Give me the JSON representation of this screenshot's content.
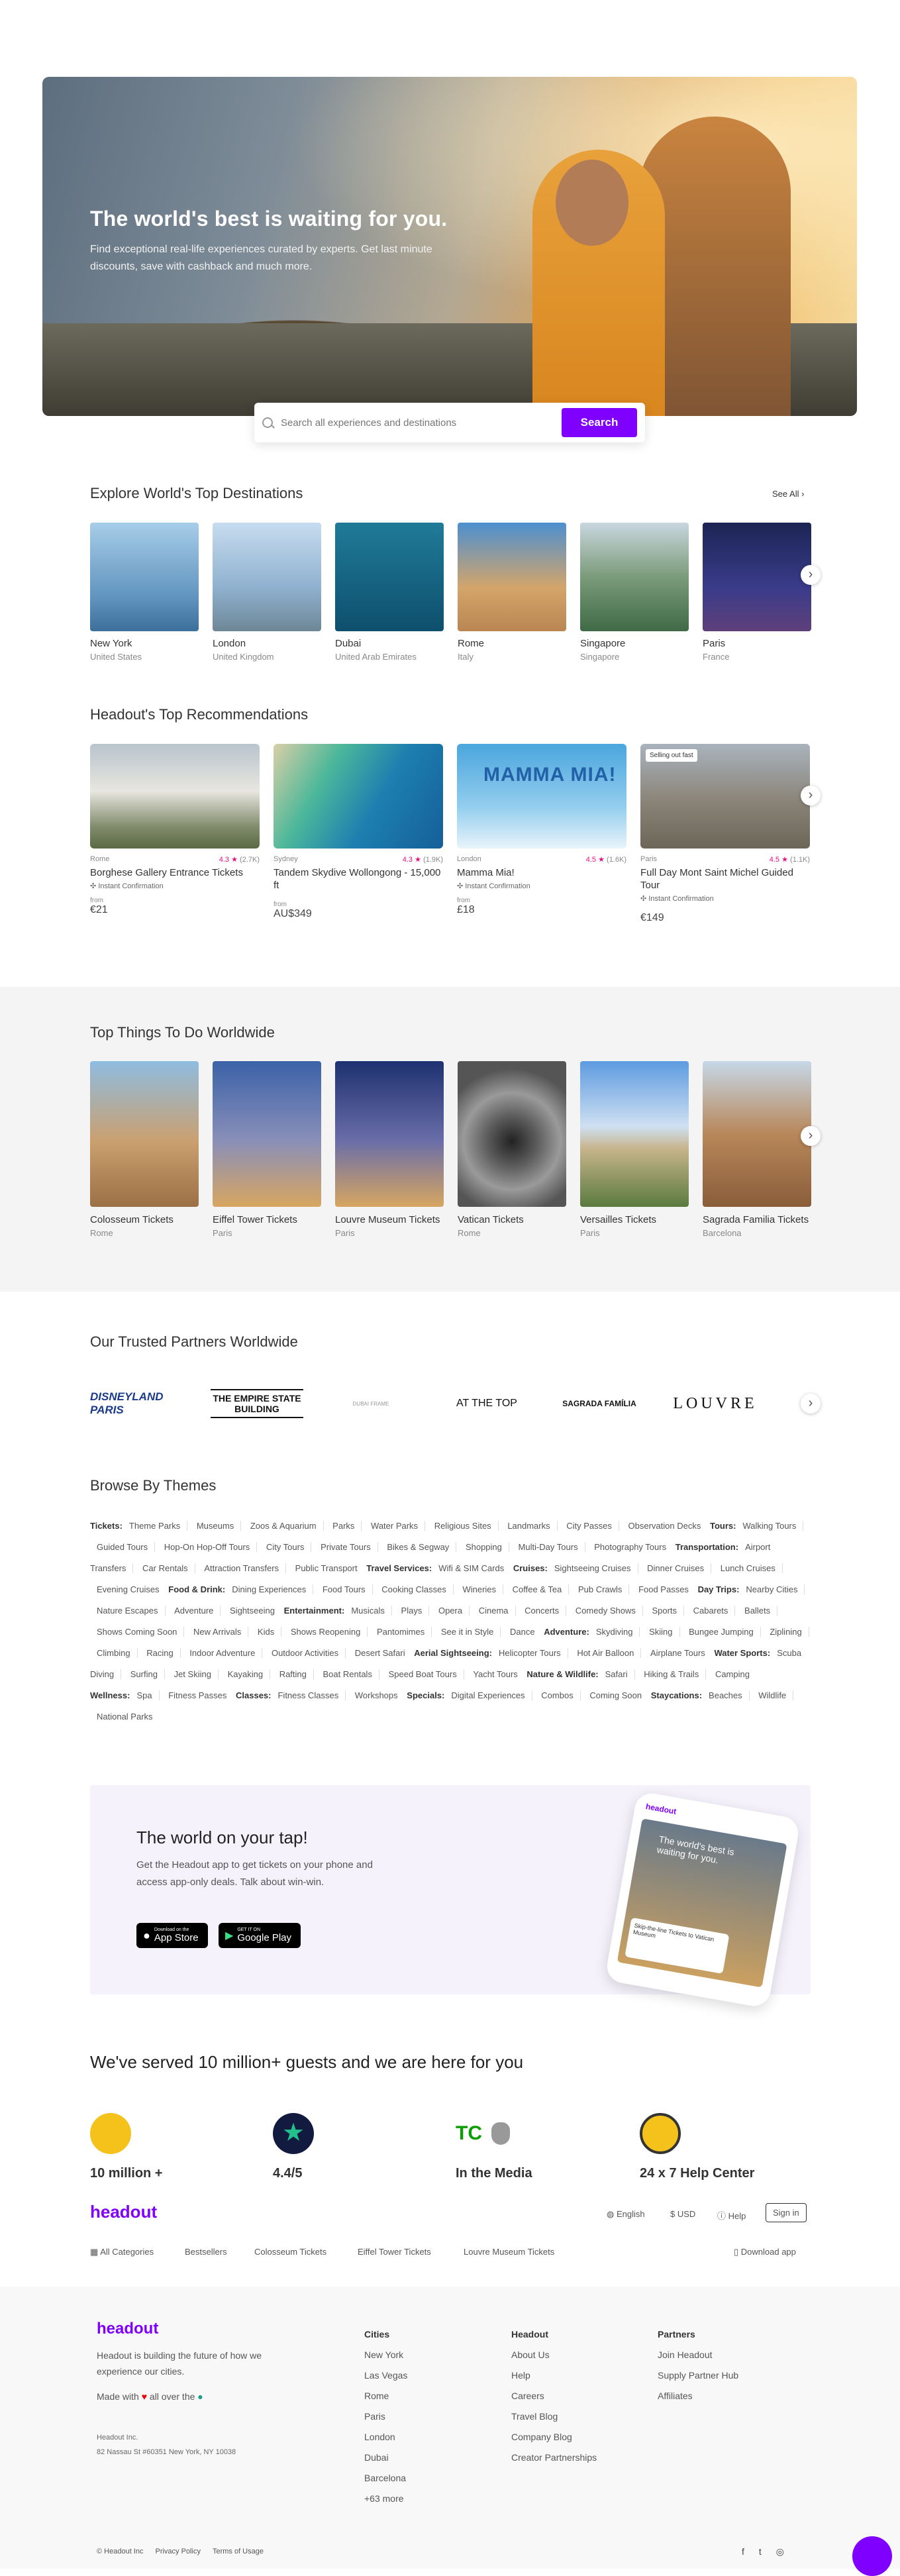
{
  "hero": {
    "title": "The world's best is waiting for you.",
    "subtitle": "Find exceptional real-life experiences curated by experts. Get last minute discounts, save with cashback and much more."
  },
  "search": {
    "placeholder": "Search all experiences and destinations",
    "button": "Search"
  },
  "destinations": {
    "title": "Explore World's Top Destinations",
    "see_all": "See All",
    "items": [
      {
        "name": "New York",
        "country": "United States"
      },
      {
        "name": "London",
        "country": "United Kingdom"
      },
      {
        "name": "Dubai",
        "country": "United Arab Emirates"
      },
      {
        "name": "Rome",
        "country": "Italy"
      },
      {
        "name": "Singapore",
        "country": "Singapore"
      },
      {
        "name": "Paris",
        "country": "France"
      }
    ]
  },
  "recommendations": {
    "title": "Headout's Top Recommendations",
    "items": [
      {
        "city": "Rome",
        "rating": "4.3 ★",
        "count": "(2.7K)",
        "title": "Borghese Gallery Entrance Tickets",
        "feature": "Instant Confirmation",
        "from": "from",
        "price": "€21",
        "badge": ""
      },
      {
        "city": "Sydney",
        "rating": "4.3 ★",
        "count": "(1.9K)",
        "title": "Tandem Skydive Wollongong - 15,000 ft",
        "feature": "",
        "from": "from",
        "price": "AU$349",
        "badge": ""
      },
      {
        "city": "London",
        "rating": "4.5 ★",
        "count": "(1.6K)",
        "title": "Mamma Mia!",
        "feature": "Instant Confirmation",
        "from": "from",
        "price": "£18",
        "badge": ""
      },
      {
        "city": "Paris",
        "rating": "4.5 ★",
        "count": "(1.1K)",
        "title": "Full Day Mont Saint Michel Guided Tour",
        "feature": "Instant Confirmation",
        "from": "",
        "price": "€149",
        "badge": "Selling out fast"
      }
    ]
  },
  "things": {
    "title": "Top Things To Do Worldwide",
    "items": [
      {
        "name": "Colosseum Tickets",
        "city": "Rome"
      },
      {
        "name": "Eiffel Tower Tickets",
        "city": "Paris"
      },
      {
        "name": "Louvre Museum Tickets",
        "city": "Paris"
      },
      {
        "name": "Vatican Tickets",
        "city": "Rome"
      },
      {
        "name": "Versailles Tickets",
        "city": "Paris"
      },
      {
        "name": "Sagrada Familia Tickets",
        "city": "Barcelona"
      }
    ]
  },
  "partners": {
    "title": "Our Trusted Partners Worldwide",
    "logos": [
      "DISNEYLAND PARIS",
      "THE EMPIRE STATE BUILDING",
      "DUBAI FRAME",
      "AT THE TOP",
      "SAGRADA FAMÍLIA",
      "LOUVRE"
    ]
  },
  "themes": {
    "title": "Browse By Themes",
    "groups": [
      {
        "label": "Tickets:",
        "items": [
          "Theme Parks",
          "Museums",
          "Zoos & Aquarium",
          "Parks",
          "Water Parks",
          "Religious Sites",
          "Landmarks",
          "City Passes",
          "Observation Decks"
        ]
      },
      {
        "label": "Tours:",
        "items": [
          "Walking Tours",
          "Guided Tours",
          "Hop-On Hop-Off Tours",
          "City Tours",
          "Private Tours",
          "Bikes & Segway",
          "Shopping",
          "Multi-Day Tours",
          "Photography Tours"
        ]
      },
      {
        "label": "Transportation:",
        "items": [
          "Airport Transfers",
          "Car Rentals",
          "Attraction Transfers",
          "Public Transport"
        ]
      },
      {
        "label": "Travel Services:",
        "items": [
          "Wifi & SIM Cards"
        ]
      },
      {
        "label": "Cruises:",
        "items": [
          "Sightseeing Cruises",
          "Dinner Cruises",
          "Lunch Cruises",
          "Evening Cruises"
        ]
      },
      {
        "label": "Food & Drink:",
        "items": [
          "Dining Experiences",
          "Food Tours",
          "Cooking Classes",
          "Wineries",
          "Coffee & Tea",
          "Pub Crawls",
          "Food Passes"
        ]
      },
      {
        "label": "Day Trips:",
        "items": [
          "Nearby Cities",
          "Nature Escapes",
          "Adventure",
          "Sightseeing"
        ]
      },
      {
        "label": "Entertainment:",
        "items": [
          "Musicals",
          "Plays",
          "Opera",
          "Cinema",
          "Concerts",
          "Comedy Shows",
          "Sports",
          "Cabarets",
          "Ballets",
          "Shows Coming Soon",
          "New Arrivals",
          "Kids",
          "Shows Reopening",
          "Pantomimes",
          "See it in Style",
          "Dance"
        ]
      },
      {
        "label": "Adventure:",
        "items": [
          "Skydiving",
          "Skiing",
          "Bungee Jumping",
          "Ziplining",
          "Climbing",
          "Racing",
          "Indoor Adventure",
          "Outdoor Activities",
          "Desert Safari"
        ]
      },
      {
        "label": "Aerial Sightseeing:",
        "items": [
          "Helicopter Tours",
          "Hot Air Balloon",
          "Airplane Tours"
        ]
      },
      {
        "label": "Water Sports:",
        "items": [
          "Scuba Diving",
          "Surfing",
          "Jet Skiing",
          "Kayaking",
          "Rafting",
          "Boat Rentals",
          "Speed Boat Tours",
          "Yacht Tours"
        ]
      },
      {
        "label": "Nature & Wildlife:",
        "items": [
          "Safari",
          "Hiking & Trails",
          "Camping"
        ]
      },
      {
        "label": "Wellness:",
        "items": [
          "Spa",
          "Fitness Passes"
        ]
      },
      {
        "label": "Classes:",
        "items": [
          "Fitness Classes",
          "Workshops"
        ]
      },
      {
        "label": "Specials:",
        "items": [
          "Digital Experiences",
          "Combos",
          "Coming Soon"
        ]
      },
      {
        "label": "Staycations:",
        "items": [
          "Beaches",
          "Wildlife",
          "National Parks"
        ]
      }
    ]
  },
  "app": {
    "title": "The world on your tap!",
    "text": "Get the Headout app to get tickets on your phone and access app-only deals. Talk about win-win.",
    "appstore_small": "Download on the",
    "appstore": "App Store",
    "play_small": "GET IT ON",
    "play": "Google Play",
    "phone_text": "The world's best is waiting for you.",
    "phone_card": "Skip-the-line Tickets to Vatican Museum"
  },
  "served": {
    "title": "We've served 10 million+ guests and we are here for you",
    "stats": [
      "10 million +",
      "4.4/5",
      "In the Media",
      "24 x 7 Help Center"
    ]
  },
  "bar": {
    "brand": "headout",
    "language": "English",
    "currency": "USD",
    "help": "Help",
    "signin": "Sign in",
    "links": [
      "All Categories",
      "Bestsellers",
      "Colosseum Tickets",
      "Eiffel Tower Tickets",
      "Louvre Museum Tickets"
    ],
    "download": "Download app"
  },
  "footer": {
    "brand": "headout",
    "tagline": "Headout is building the future of how we experience our cities.",
    "made_with": "Made with",
    "all_over": "all over the",
    "company": "Headout Inc.",
    "address": "82 Nassau St #60351 New York, NY 10038",
    "cities_title": "Cities",
    "cities": [
      "New York",
      "Las Vegas",
      "Rome",
      "Paris",
      "London",
      "Dubai",
      "Barcelona",
      "+63 more"
    ],
    "headout_title": "Headout",
    "headout_links": [
      "About Us",
      "Help",
      "Careers",
      "Travel Blog",
      "Company Blog",
      "Creator Partnerships"
    ],
    "partners_title": "Partners",
    "partners_links": [
      "Join Headout",
      "Supply Partner Hub",
      "Affiliates"
    ],
    "legal": [
      "© Headout Inc",
      "Privacy Policy",
      "Terms of Usage"
    ]
  },
  "colors": {
    "brand": "#8000ff",
    "rating": "#e5107e"
  }
}
